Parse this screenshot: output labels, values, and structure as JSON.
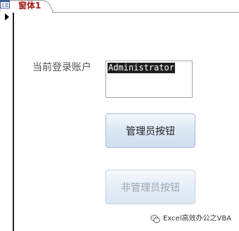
{
  "tab": {
    "title": "窗体1",
    "icon": "form-icon"
  },
  "form": {
    "label": "当前登录账户",
    "username": "Administrator",
    "admin_button": "管理员按钮",
    "nonadmin_button": "非管理员按钮"
  },
  "watermark": {
    "text": "Excel高效办公之VBA"
  },
  "colors": {
    "tab_text": "#a21b1b",
    "button_top": "#f4f8fc",
    "button_bottom": "#cfdef0",
    "disabled_text": "#9aa6b3"
  }
}
